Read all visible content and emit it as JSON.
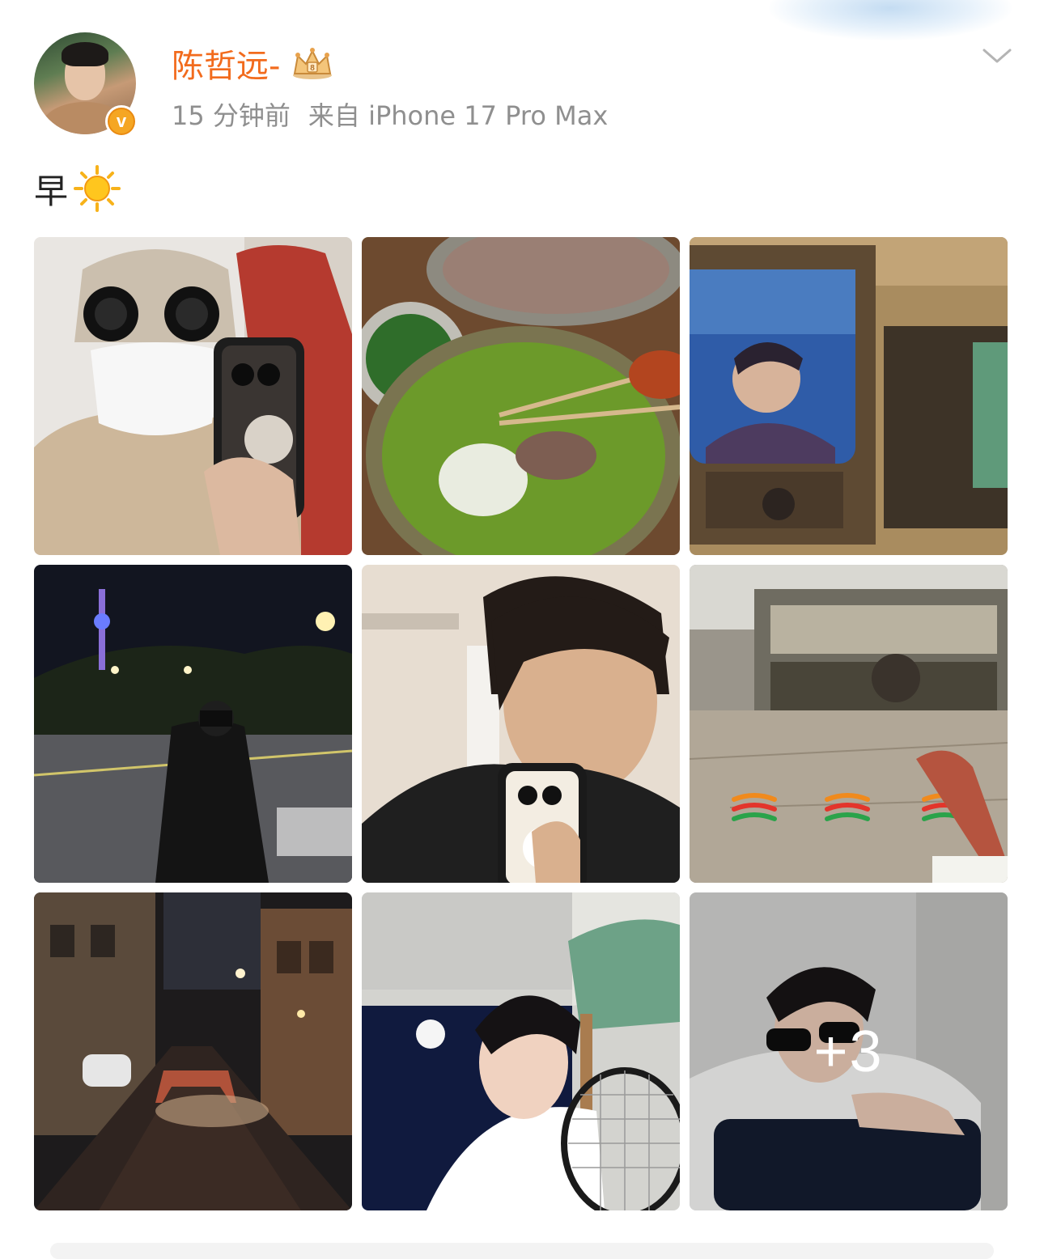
{
  "post": {
    "author": {
      "name": "陈哲远-",
      "verified_badge_letter": "v",
      "crown_icon": "vip-crown-icon"
    },
    "time": "15 分钟前",
    "source": "来自 iPhone 17 Pro Max",
    "text": "早",
    "text_emoji": "sun-emoji",
    "images": [
      "photo-knit-beanie-mirror-selfie",
      "photo-beef-soup-meal",
      "photo-retro-tv-screen",
      "photo-night-street-tower",
      "photo-close-mirror-selfie",
      "photo-convenience-store-window",
      "photo-night-alley",
      "photo-tennis-racket-portrait",
      "photo-sunglasses-portrait"
    ],
    "more_images_label": "+3"
  },
  "colors": {
    "username": "#f26b1d",
    "meta": "#8f8f8f",
    "verified": "#f5a623"
  }
}
